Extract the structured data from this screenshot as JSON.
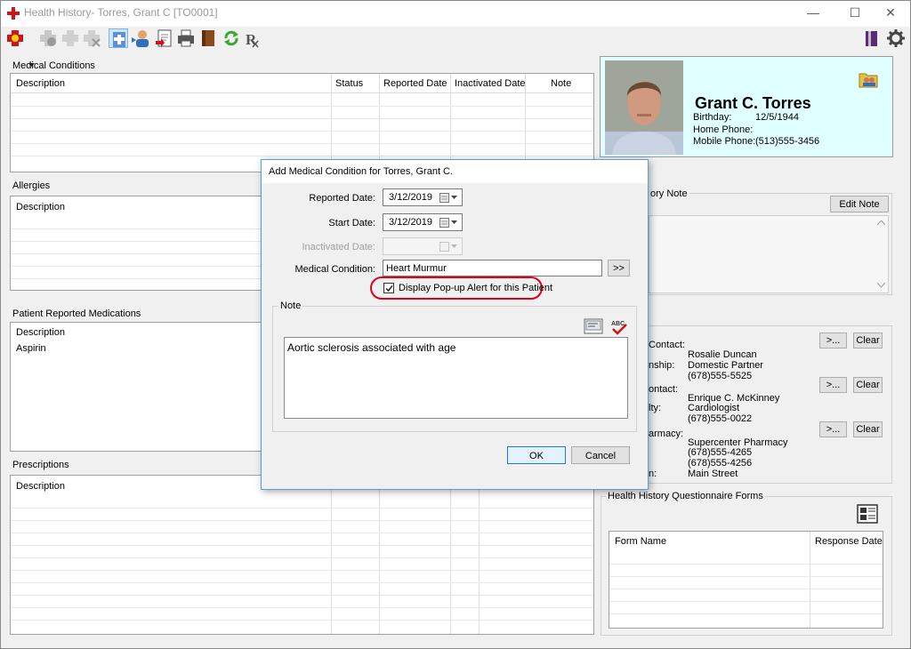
{
  "window": {
    "title": "Health History- Torres, Grant C [TO0001]",
    "minimize": "—",
    "maximize": "☐",
    "close": "✕"
  },
  "sections": {
    "medical_conditions": {
      "label": "Medical Conditions",
      "columns": [
        "Description",
        "Status",
        "Reported Date",
        "Inactivated Date",
        "Note"
      ]
    },
    "allergies": {
      "label": "Allergies",
      "columns": [
        "Description"
      ]
    },
    "patient_meds": {
      "label": "Patient Reported Medications",
      "columns": [
        "Description"
      ],
      "rows": [
        "Aspirin"
      ]
    },
    "prescriptions": {
      "label": "Prescriptions",
      "columns": [
        "Description"
      ]
    }
  },
  "patient": {
    "name": "Grant C. Torres",
    "birthday_label": "Birthday:",
    "birthday": "12/5/1944",
    "home_phone_label": "Home Phone:",
    "home_phone": "",
    "mobile_phone_label": "Mobile Phone:",
    "mobile_phone": "(513)555-3456"
  },
  "history_note": {
    "label": "ory Note",
    "edit_button": "Edit Note"
  },
  "contacts": {
    "emergency": {
      "label": "Contact:",
      "name": "Rosalie Duncan",
      "rel_label": "nship:",
      "relationship": "Domestic Partner",
      "phone": "(678)555-5525"
    },
    "physician": {
      "label": "ontact:",
      "name": "Enrique C. McKinney",
      "spec_label": "lty:",
      "specialty": "Cardiologist",
      "phone": "(678)555-0022"
    },
    "pharmacy": {
      "label": "armacy:",
      "name": "Supercenter Pharmacy",
      "phone1": "(678)555-4265",
      "phone2": "(678)555-4256",
      "loc_label": "n:",
      "address": "Main Street"
    },
    "select_button": ">...",
    "clear_button": "Clear"
  },
  "questionnaire": {
    "label": "Health History Questionnaire Forms",
    "columns": [
      "Form Name",
      "Response Date"
    ]
  },
  "dialog": {
    "title": "Add Medical Condition for Torres, Grant C.",
    "reported_date_label": "Reported Date:",
    "reported_date": "3/12/2019",
    "start_date_label": "Start Date:",
    "start_date": "3/12/2019",
    "inactivated_date_label": "Inactivated Date:",
    "inactivated_date": "",
    "medical_condition_label": "Medical Condition:",
    "medical_condition": "Heart Murmur",
    "browse_button": ">>",
    "popup_checkbox_label": "Display Pop-up Alert for this Patient",
    "popup_checked": true,
    "note_label": "Note",
    "note_text": "Aortic sclerosis associated with age",
    "ok_button": "OK",
    "cancel_button": "Cancel"
  },
  "colors": {
    "patient_card_bg": "#e0ffff",
    "highlight_ring": "#e0001b",
    "dialog_border": "#5a9fd4"
  }
}
